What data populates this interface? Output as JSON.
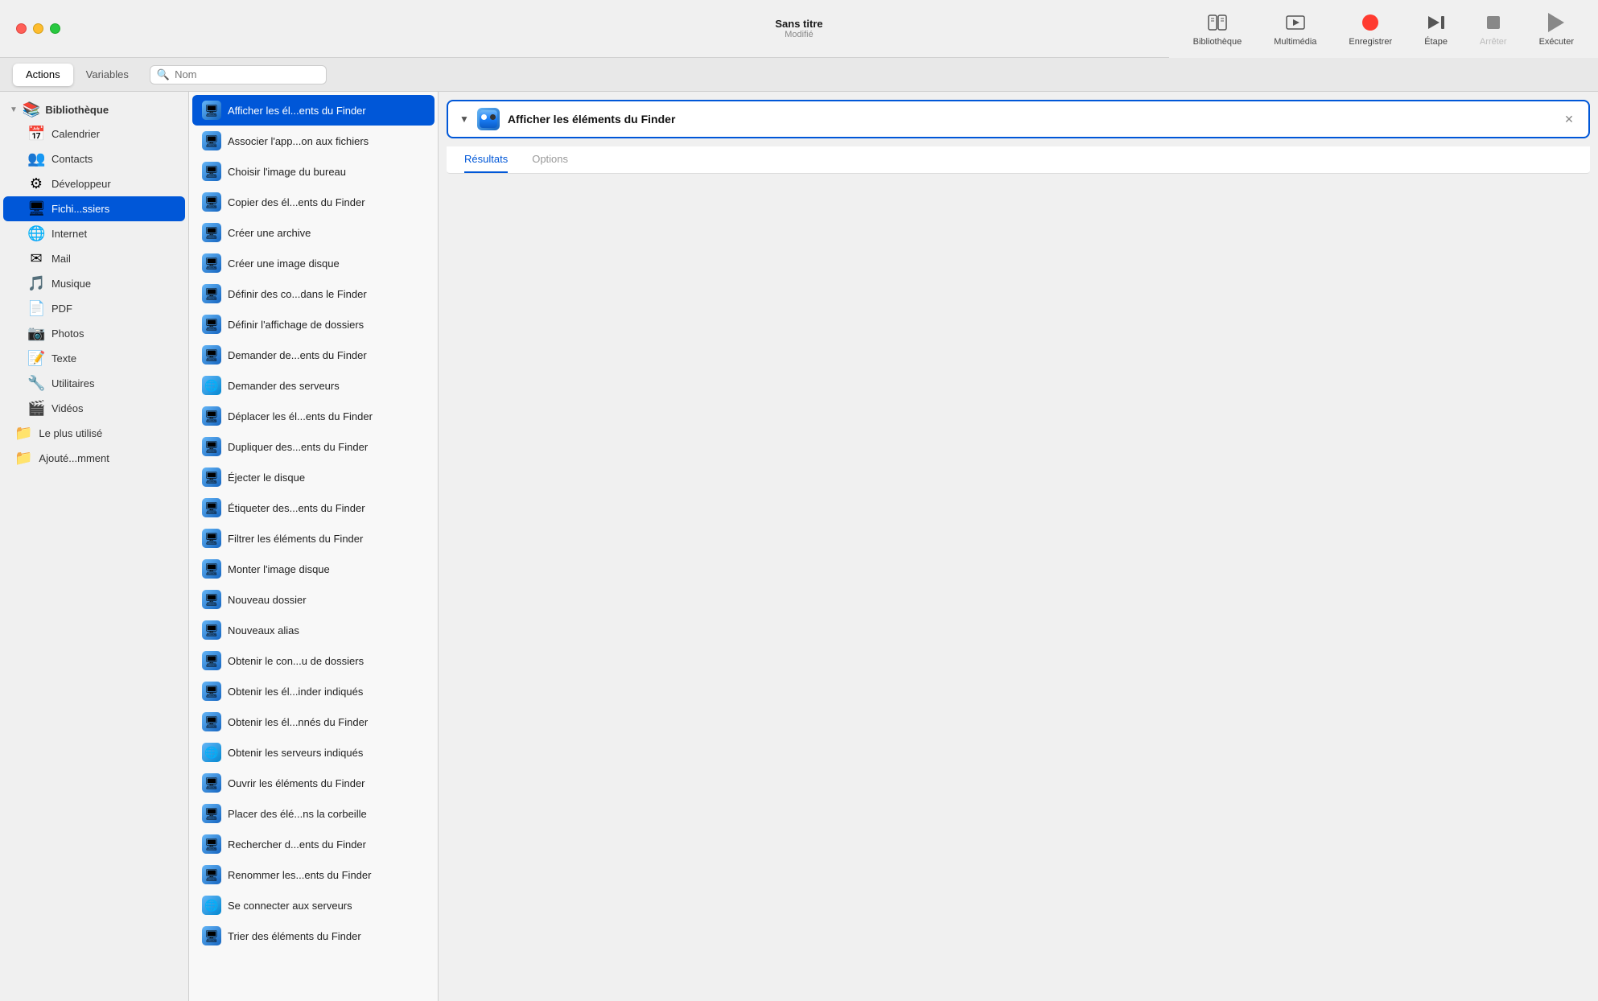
{
  "titlebar": {
    "title": "Sans titre",
    "subtitle": "Modifié"
  },
  "toolbar": {
    "items": [
      {
        "id": "library",
        "label": "Bibliothèque",
        "icon": "library"
      },
      {
        "id": "multimedia",
        "label": "Multimédia",
        "icon": "multimedia"
      },
      {
        "id": "record",
        "label": "Enregistrer",
        "icon": "record"
      },
      {
        "id": "step",
        "label": "Étape",
        "icon": "step"
      },
      {
        "id": "stop",
        "label": "Arrêter",
        "icon": "stop",
        "disabled": true
      },
      {
        "id": "run",
        "label": "Exécuter",
        "icon": "run"
      }
    ]
  },
  "tabbar": {
    "tabs": [
      {
        "id": "actions",
        "label": "Actions",
        "active": true
      },
      {
        "id": "variables",
        "label": "Variables",
        "active": false
      }
    ],
    "search_placeholder": "Nom"
  },
  "sidebar": {
    "header": {
      "label": "Bibliothèque",
      "collapsed": true
    },
    "items": [
      {
        "id": "calendrier",
        "label": "Calendrier",
        "icon": "📅"
      },
      {
        "id": "contacts",
        "label": "Contacts",
        "icon": "👥"
      },
      {
        "id": "developpeur",
        "label": "Développeur",
        "icon": "⚙"
      },
      {
        "id": "fichiers",
        "label": "Fichi...ssiers",
        "icon": "finder",
        "active": true
      },
      {
        "id": "internet",
        "label": "Internet",
        "icon": "🌐"
      },
      {
        "id": "mail",
        "label": "Mail",
        "icon": "✉"
      },
      {
        "id": "musique",
        "label": "Musique",
        "icon": "🎵"
      },
      {
        "id": "pdf",
        "label": "PDF",
        "icon": "📄"
      },
      {
        "id": "photos",
        "label": "Photos",
        "icon": "📷"
      },
      {
        "id": "texte",
        "label": "Texte",
        "icon": "📝"
      },
      {
        "id": "utilitaires",
        "label": "Utilitaires",
        "icon": "🔧"
      },
      {
        "id": "videos",
        "label": "Vidéos",
        "icon": "🎬"
      }
    ],
    "sections": [
      {
        "id": "plus-utilise",
        "label": "Le plus utilisé",
        "icon": "folder"
      },
      {
        "id": "ajoute",
        "label": "Ajouté...mment",
        "icon": "folder"
      }
    ]
  },
  "actions_list": {
    "items": [
      {
        "id": "afficher-elements",
        "label": "Afficher les él...ents du Finder",
        "icon": "finder",
        "selected": true
      },
      {
        "id": "associer-app",
        "label": "Associer l'app...on aux fichiers",
        "icon": "finder"
      },
      {
        "id": "choisir-image",
        "label": "Choisir l'image du bureau",
        "icon": "finder"
      },
      {
        "id": "copier-elements",
        "label": "Copier des él...ents du Finder",
        "icon": "finder"
      },
      {
        "id": "creer-archive",
        "label": "Créer une archive",
        "icon": "finder"
      },
      {
        "id": "creer-image-disque",
        "label": "Créer une image disque",
        "icon": "finder"
      },
      {
        "id": "definir-commentaires",
        "label": "Définir des co...dans le Finder",
        "icon": "finder"
      },
      {
        "id": "definir-affichage",
        "label": "Définir l'affichage de dossiers",
        "icon": "finder"
      },
      {
        "id": "demander-elements",
        "label": "Demander de...ents du Finder",
        "icon": "finder"
      },
      {
        "id": "demander-serveurs",
        "label": "Demander des serveurs",
        "icon": "globe"
      },
      {
        "id": "deplacer-elements",
        "label": "Déplacer les él...ents du Finder",
        "icon": "finder"
      },
      {
        "id": "dupliquer-elements",
        "label": "Dupliquer des...ents du Finder",
        "icon": "finder"
      },
      {
        "id": "ejecter-disque",
        "label": "Éjecter le disque",
        "icon": "finder"
      },
      {
        "id": "etiqueter-elements",
        "label": "Étiqueter des...ents du Finder",
        "icon": "finder"
      },
      {
        "id": "filtrer-elements",
        "label": "Filtrer les éléments du Finder",
        "icon": "finder"
      },
      {
        "id": "monter-image",
        "label": "Monter l'image disque",
        "icon": "finder"
      },
      {
        "id": "nouveau-dossier",
        "label": "Nouveau dossier",
        "icon": "finder"
      },
      {
        "id": "nouveaux-alias",
        "label": "Nouveaux alias",
        "icon": "finder"
      },
      {
        "id": "obtenir-contenu",
        "label": "Obtenir le con...u de dossiers",
        "icon": "finder"
      },
      {
        "id": "obtenir-elements-finder",
        "label": "Obtenir les él...inder indiqués",
        "icon": "finder"
      },
      {
        "id": "obtenir-elements-donnees",
        "label": "Obtenir les él...nnés du Finder",
        "icon": "finder"
      },
      {
        "id": "obtenir-serveurs",
        "label": "Obtenir les serveurs indiqués",
        "icon": "globe"
      },
      {
        "id": "ouvrir-elements",
        "label": "Ouvrir les éléments du Finder",
        "icon": "finder"
      },
      {
        "id": "placer-corbeille",
        "label": "Placer des élé...ns la corbeille",
        "icon": "finder"
      },
      {
        "id": "rechercher-elements",
        "label": "Rechercher d...ents du Finder",
        "icon": "finder"
      },
      {
        "id": "renommer-elements",
        "label": "Renommer les...ents du Finder",
        "icon": "finder"
      },
      {
        "id": "connecter-serveurs",
        "label": "Se connecter aux serveurs",
        "icon": "globe"
      },
      {
        "id": "trier-elements",
        "label": "Trier des éléments du Finder",
        "icon": "finder"
      }
    ]
  },
  "detail": {
    "title": "Afficher les éléments du Finder",
    "tabs": [
      {
        "id": "resultats",
        "label": "Résultats",
        "active": true
      },
      {
        "id": "options",
        "label": "Options",
        "active": false
      }
    ]
  }
}
